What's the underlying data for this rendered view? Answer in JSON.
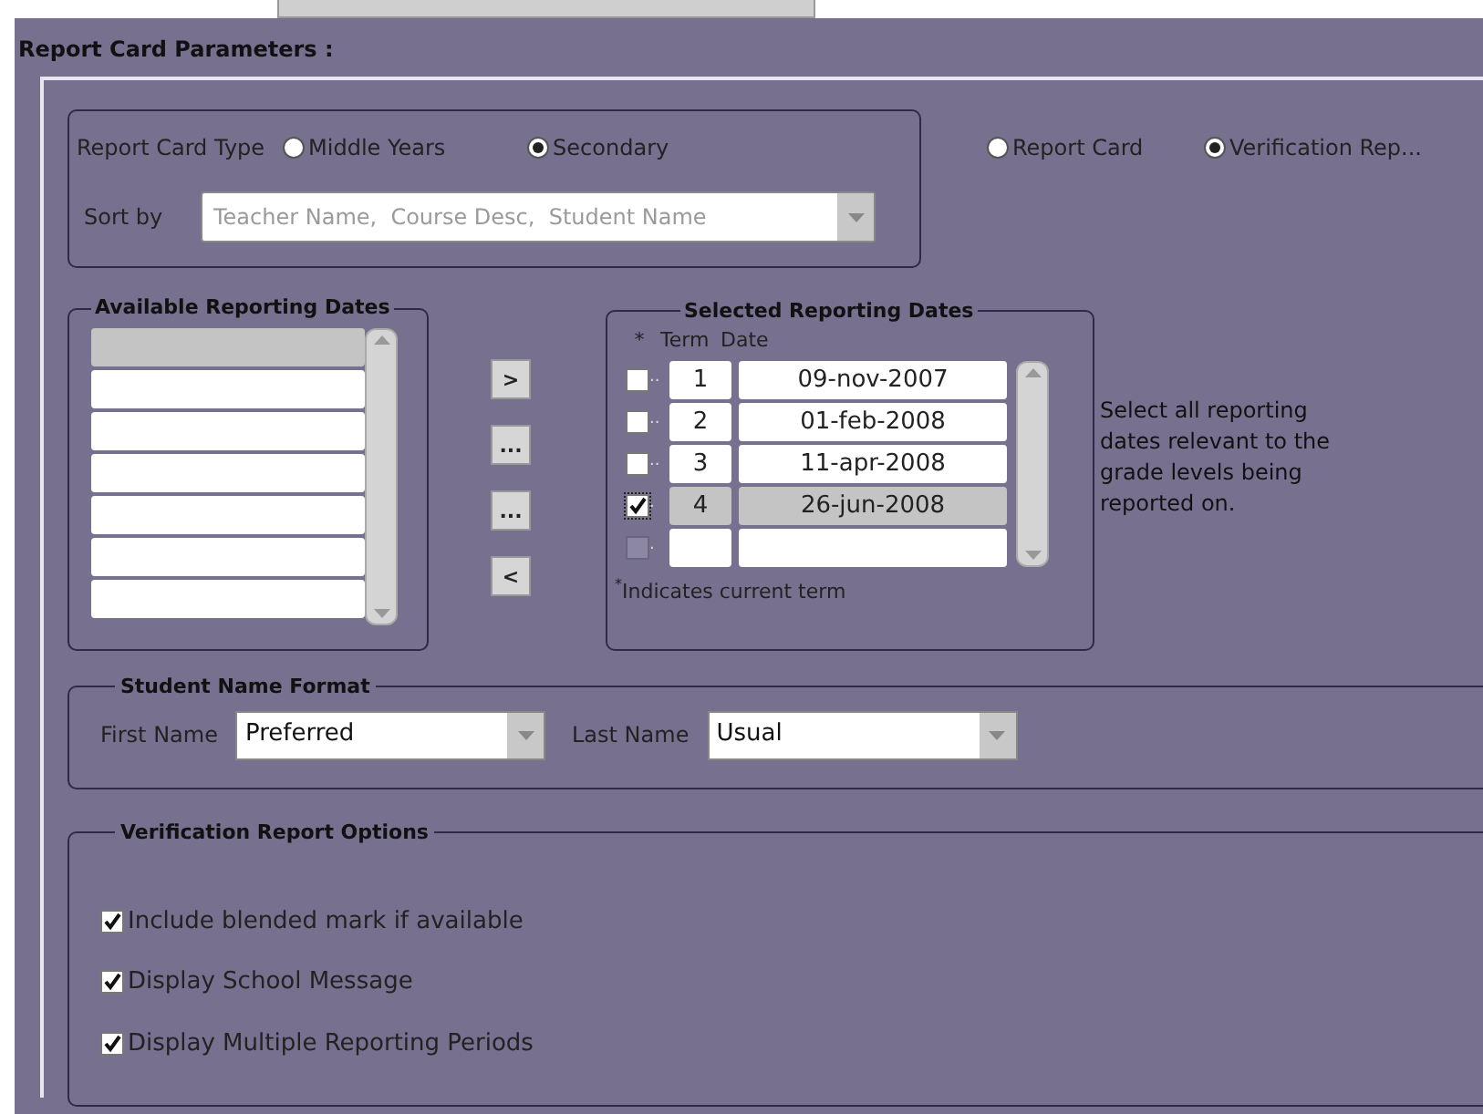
{
  "title": "Report Card Parameters :",
  "report_card_type": {
    "label": "Report Card Type",
    "options": [
      {
        "label": "Middle Years",
        "selected": false
      },
      {
        "label": "Secondary",
        "selected": true
      }
    ]
  },
  "sort_by": {
    "label": "Sort by",
    "value": "Teacher Name,  Course Desc,  Student Name"
  },
  "report_kind": [
    {
      "label": "Report Card",
      "selected": false
    },
    {
      "label": "Verification Rep...",
      "selected": true
    }
  ],
  "available_dates": {
    "legend": "Available Reporting Dates",
    "rows": [
      {
        "selected": true
      },
      {
        "selected": false
      },
      {
        "selected": false
      },
      {
        "selected": false
      },
      {
        "selected": false
      },
      {
        "selected": false
      },
      {
        "selected": false
      }
    ]
  },
  "move_buttons": [
    ">",
    "...",
    "...",
    "<"
  ],
  "selected_dates": {
    "legend": "Selected Reporting Dates",
    "columns": [
      "*",
      "Term",
      "Date"
    ],
    "rows": [
      {
        "marker": "..",
        "term": "1",
        "date": "09-nov-2007",
        "current": false,
        "selected": false,
        "disabled": false
      },
      {
        "marker": "..",
        "term": "2",
        "date": "01-feb-2008",
        "current": false,
        "selected": false,
        "disabled": false
      },
      {
        "marker": "..",
        "term": "3",
        "date": "11-apr-2008",
        "current": false,
        "selected": false,
        "disabled": false
      },
      {
        "marker": ".",
        "term": "4",
        "date": "26-jun-2008",
        "current": true,
        "selected": true,
        "disabled": false
      },
      {
        "marker": ".",
        "current": false,
        "selected": false,
        "disabled": true
      }
    ],
    "footnote_mark": "*",
    "footnote": "Indicates current term"
  },
  "help_text": "Select all reporting dates relevant to the grade levels being reported on.",
  "student_name_format": {
    "legend": "Student Name Format",
    "fields": [
      {
        "label": "First Name",
        "value": "Preferred"
      },
      {
        "label": "Last Name",
        "value": "Usual"
      }
    ]
  },
  "verification_options": {
    "legend": "Verification Report Options",
    "options": [
      {
        "label": "Include blended mark if available",
        "checked": true
      },
      {
        "label": "Display School Message",
        "checked": true
      },
      {
        "label": "Display Multiple Reporting Periods",
        "checked": true
      }
    ]
  }
}
